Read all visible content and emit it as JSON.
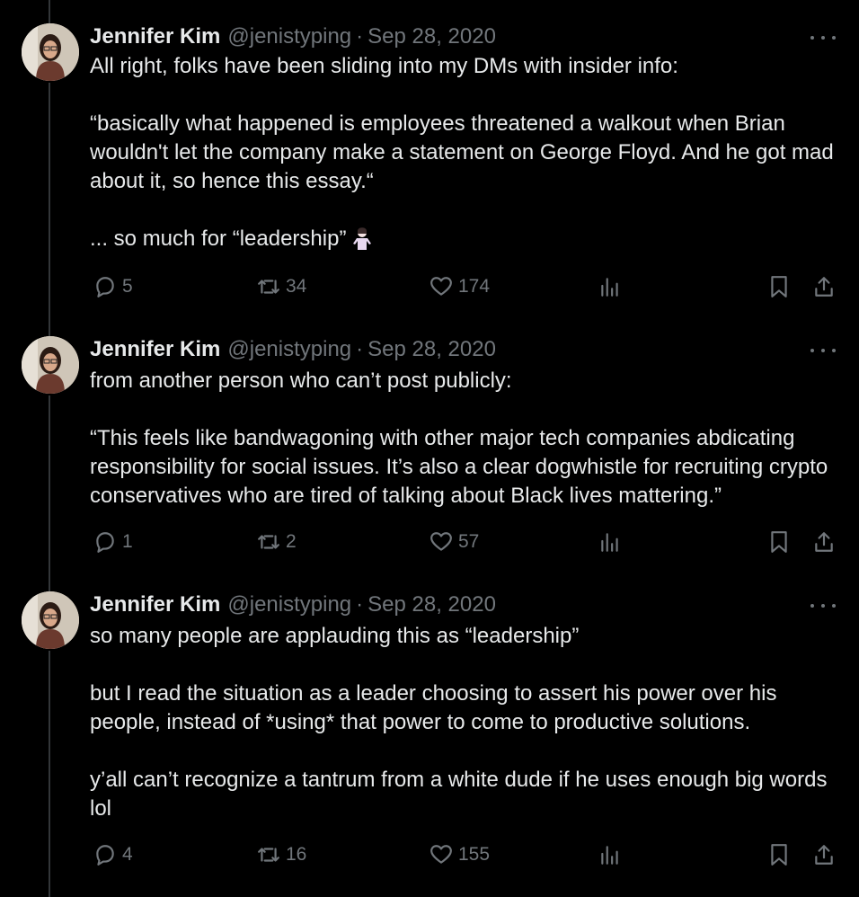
{
  "tweets": [
    {
      "name": "Jennifer Kim",
      "handle": "@jenistyping",
      "separator": "·",
      "date": "Sep 28, 2020",
      "paragraphs": [
        "All right, folks have been sliding into my DMs with insider info:",
        "“basically what happened is employees threatened a walkout when Brian wouldn't let the company make a statement on George Floyd. And he got mad about it, so hence this essay.“",
        "... so much for “leadership”"
      ],
      "emoji": "person-shrugging-emoji",
      "replies": "5",
      "retweets": "34",
      "likes": "174"
    },
    {
      "name": "Jennifer Kim",
      "handle": "@jenistyping",
      "separator": "·",
      "date": "Sep 28, 2020",
      "paragraphs": [
        "from another person who can’t post publicly:",
        "“This feels like bandwagoning with other major tech companies abdicating responsibility for social issues. It’s also a clear dogwhistle for recruiting crypto conservatives who are tired of talking about Black lives mattering.”"
      ],
      "replies": "1",
      "retweets": "2",
      "likes": "57"
    },
    {
      "name": "Jennifer Kim",
      "handle": "@jenistyping",
      "separator": "·",
      "date": "Sep 28, 2020",
      "paragraphs": [
        "so many people are applauding this as “leadership”",
        "but I read the situation as a leader choosing to assert his power over his people, instead of *using* that power to come to productive solutions.",
        "y’all can’t recognize a tantrum from a white dude if he uses enough big words lol"
      ],
      "replies": "4",
      "retweets": "16",
      "likes": "155"
    }
  ],
  "icons": {
    "reply": "reply-icon",
    "retweet": "retweet-icon",
    "like": "heart-icon",
    "views": "views-icon",
    "bookmark": "bookmark-icon",
    "share": "share-icon",
    "more": "more-icon"
  },
  "colors": {
    "background": "#000000",
    "text": "#e7e9ea",
    "muted": "#71767b",
    "thread_line": "#333639"
  }
}
